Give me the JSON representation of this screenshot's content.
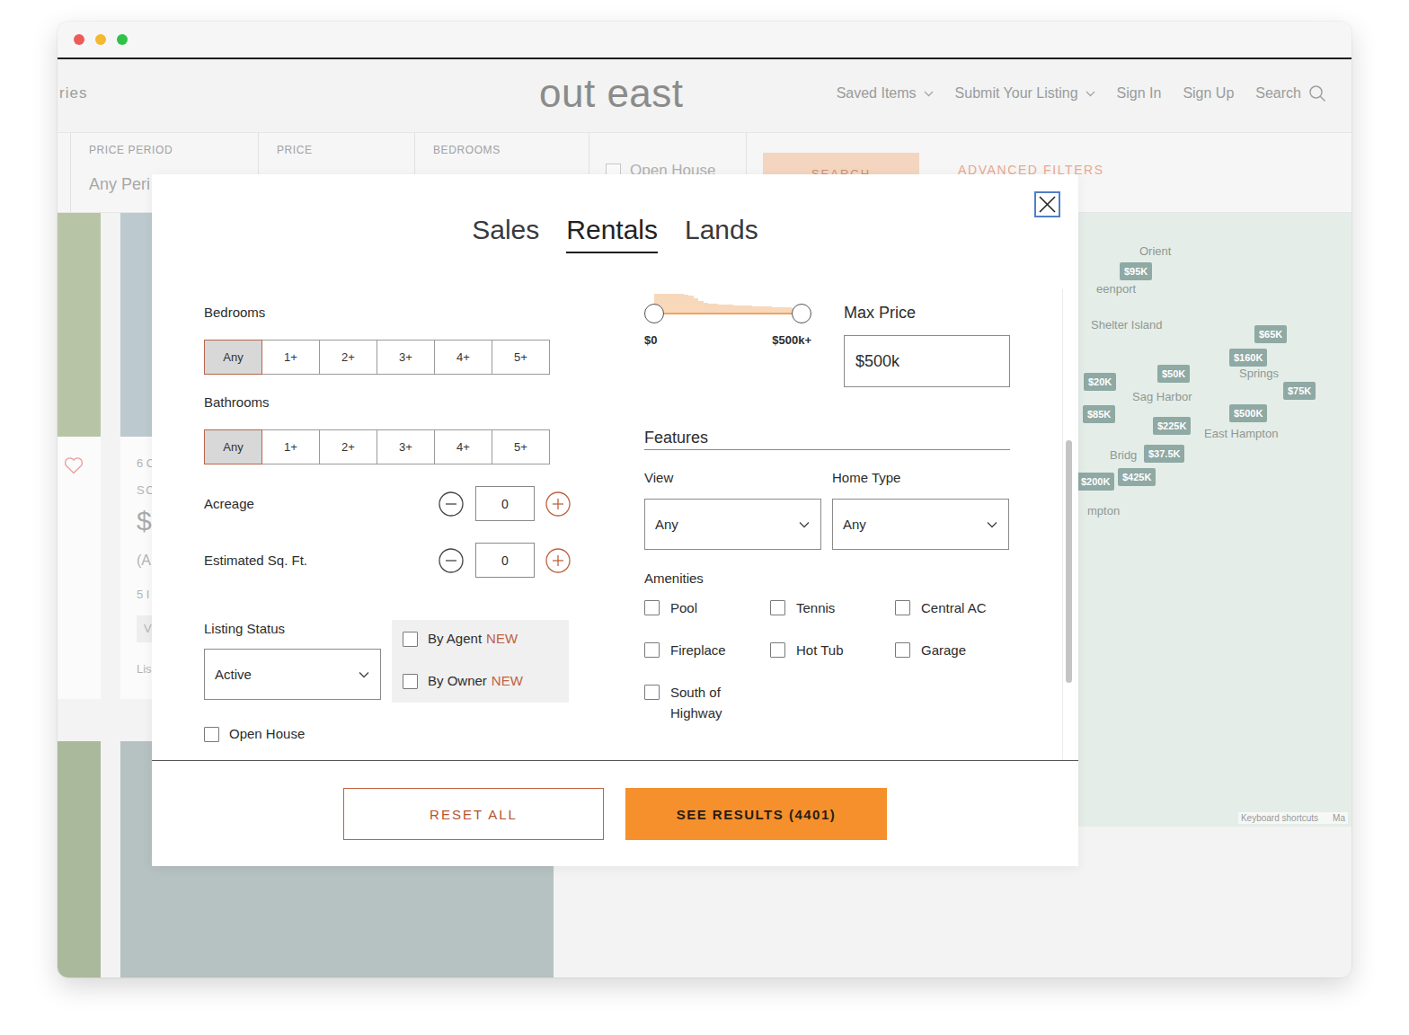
{
  "browser": {
    "controls": [
      {
        "color": "#ee5b57"
      },
      {
        "color": "#f5b82e"
      },
      {
        "color": "#30c148"
      }
    ]
  },
  "header": {
    "edge_link": "ries",
    "logo": "out east",
    "nav": [
      {
        "label": "Saved Items",
        "kind": "menu"
      },
      {
        "label": "Submit Your Listing",
        "kind": "menu"
      },
      {
        "label": "Sign In",
        "kind": "link"
      },
      {
        "label": "Sign Up",
        "kind": "link"
      },
      {
        "label": "Search",
        "kind": "search"
      }
    ]
  },
  "filter_bar": {
    "fields": [
      {
        "label": "PRICE PERIOD",
        "value": "Any Peri"
      },
      {
        "label": "PRICE"
      },
      {
        "label": "BEDROOMS"
      }
    ],
    "open_house": {
      "label": "Open House",
      "checked": false
    },
    "search_button": "SEARCH",
    "advanced_link": "ADVANCED FILTERS"
  },
  "listings": {
    "rows": [
      [
        {
          "saved": false,
          "lines": []
        },
        {
          "lines": [
            {
              "text": "6 C",
              "kind": "meta"
            },
            {
              "text": "SC",
              "kind": "label"
            },
            {
              "text": "$",
              "kind": "price"
            },
            {
              "text": "(A",
              "kind": "note"
            },
            {
              "text": "5 I",
              "kind": "meta"
            },
            {
              "text": "V",
              "kind": "button"
            },
            {
              "text": "Lis",
              "kind": "meta"
            }
          ]
        }
      ],
      [
        {
          "lines": []
        },
        {
          "lines": []
        }
      ]
    ]
  },
  "map": {
    "places": [
      "Orient",
      "eenport",
      "Shelter Island",
      "Sag Harbor",
      "Springs",
      "East Hampton",
      "Bridg",
      "mpton"
    ],
    "pins": [
      "$95K",
      "$65K",
      "$160K",
      "$50K",
      "$20K",
      "$75K",
      "$85K",
      "$500K",
      "$225K",
      "$37.5K",
      "$200K",
      "$425K"
    ],
    "attribution": [
      "Keyboard shortcuts",
      "Ma"
    ]
  },
  "modal": {
    "tabs": [
      {
        "label": "Sales",
        "selected": false
      },
      {
        "label": "Rentals",
        "selected": true
      },
      {
        "label": "Lands",
        "selected": false
      }
    ],
    "bedrooms": {
      "label": "Bedrooms",
      "options": [
        {
          "label": "Any",
          "selected": true
        },
        {
          "label": "1+",
          "selected": false
        },
        {
          "label": "2+",
          "selected": false
        },
        {
          "label": "3+",
          "selected": false
        },
        {
          "label": "4+",
          "selected": false
        },
        {
          "label": "5+",
          "selected": false
        }
      ]
    },
    "bathrooms": {
      "label": "Bathrooms",
      "options": [
        {
          "label": "Any",
          "selected": true
        },
        {
          "label": "1+",
          "selected": false
        },
        {
          "label": "2+",
          "selected": false
        },
        {
          "label": "3+",
          "selected": false
        },
        {
          "label": "4+",
          "selected": false
        },
        {
          "label": "5+",
          "selected": false
        }
      ]
    },
    "steppers": [
      {
        "label": "Acreage",
        "value": "0"
      },
      {
        "label": "Estimated Sq. Ft.",
        "value": "0"
      }
    ],
    "listing_status": {
      "label": "Listing Status",
      "value": "Active"
    },
    "sources": [
      {
        "label": "By Agent",
        "badge": "NEW",
        "checked": false
      },
      {
        "label": "By Owner",
        "badge": "NEW",
        "checked": false
      }
    ],
    "open_house": {
      "label": "Open House",
      "checked": false
    },
    "price": {
      "histogram": [
        21,
        21,
        21,
        21,
        21,
        21,
        20,
        19,
        16,
        13,
        11,
        10,
        10,
        9,
        9,
        9,
        8,
        8,
        8,
        8,
        7,
        7,
        7,
        7,
        6,
        6,
        6,
        6,
        5,
        5
      ],
      "handles": [
        {
          "level": 0
        },
        {
          "level": 1
        }
      ],
      "min_label": "$0",
      "max_label": "$500k+",
      "max_price": {
        "label": "Max Price",
        "value": "$500k"
      }
    },
    "features": {
      "title": "Features",
      "selects": [
        {
          "label": "View",
          "value": "Any"
        },
        {
          "label": "Home Type",
          "value": "Any"
        }
      ],
      "amenities_label": "Amenities",
      "amenities": [
        {
          "label": "Pool",
          "checked": false
        },
        {
          "label": "Tennis",
          "checked": false
        },
        {
          "label": "Central AC",
          "checked": false
        },
        {
          "label": "Fireplace",
          "checked": false
        },
        {
          "label": "Hot Tub",
          "checked": false
        },
        {
          "label": "Garage",
          "checked": false
        },
        {
          "label": "South of Highway",
          "checked": false
        }
      ]
    },
    "scrollbar": {
      "position": 0.32
    },
    "footer": {
      "reset": "RESET ALL",
      "results": "SEE RESULTS (4401)"
    }
  }
}
